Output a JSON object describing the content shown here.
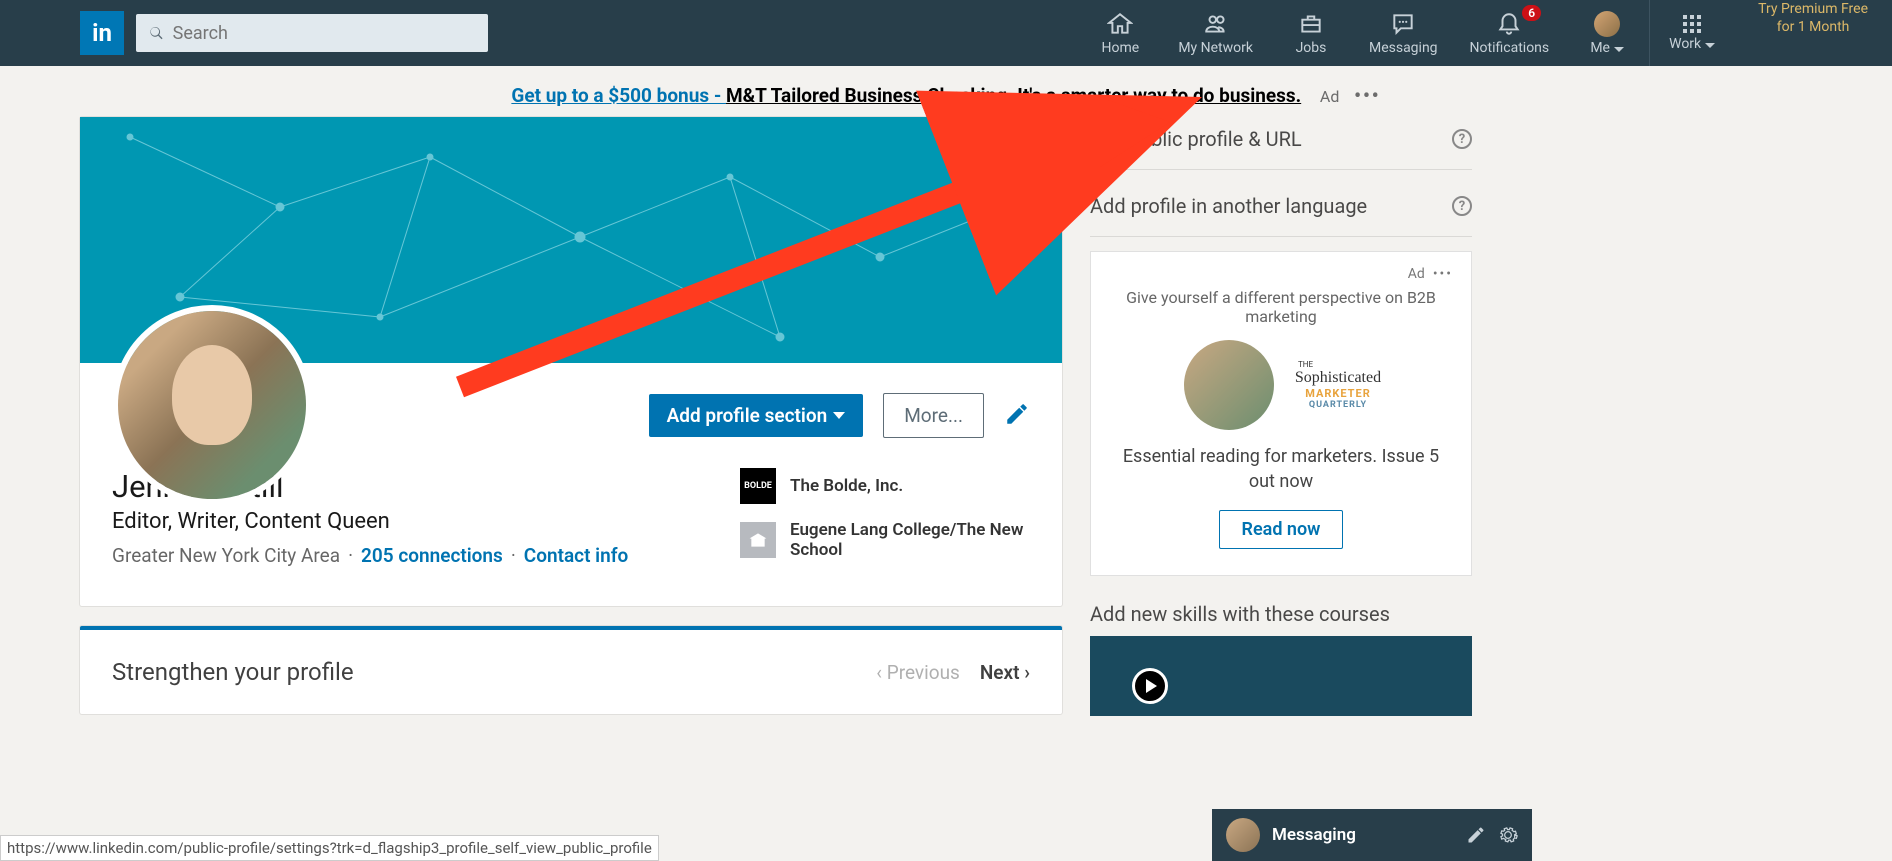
{
  "nav": {
    "search_placeholder": "Search",
    "items": [
      "Home",
      "My Network",
      "Jobs",
      "Messaging",
      "Notifications",
      "Me",
      "Work"
    ],
    "badge": "6",
    "premium_line1": "Try Premium Free",
    "premium_line2": "for 1 Month"
  },
  "ad_banner": {
    "link": "Get up to a $500 bonus - ",
    "text": "M&T Tailored Business Checking. It's a smarter way to do business.",
    "label": "Ad"
  },
  "profile": {
    "add_section": "Add profile section",
    "more": "More...",
    "name": "Jennifer Still",
    "headline": "Editor, Writer, Content Queen",
    "location": "Greater New York City Area",
    "connections": "205 connections",
    "contact": "Contact info",
    "orgs": [
      {
        "logo": "BOLDE",
        "name": "The Bolde, Inc."
      },
      {
        "logo": "",
        "name": "Eugene Lang College/The New School"
      }
    ]
  },
  "strengthen": {
    "title": "Strengthen your profile",
    "prev": "Previous",
    "next": "Next"
  },
  "side": {
    "edit_url": "Edit public profile & URL",
    "add_lang": "Add profile in another language",
    "ad_label": "Ad",
    "ad_text1": "Give yourself a different perspective on B2B marketing",
    "ad_brand1": "Sophisticated",
    "ad_brand2": "MARKETER",
    "ad_brand3": "QUARTERLY",
    "ad_text2": "Essential reading for marketers. Issue 5 out now",
    "ad_btn": "Read now",
    "courses": "Add new skills with these courses"
  },
  "messaging": {
    "label": "Messaging"
  },
  "status_url": "https://www.linkedin.com/public-profile/settings?trk=d_flagship3_profile_self_view_public_profile"
}
